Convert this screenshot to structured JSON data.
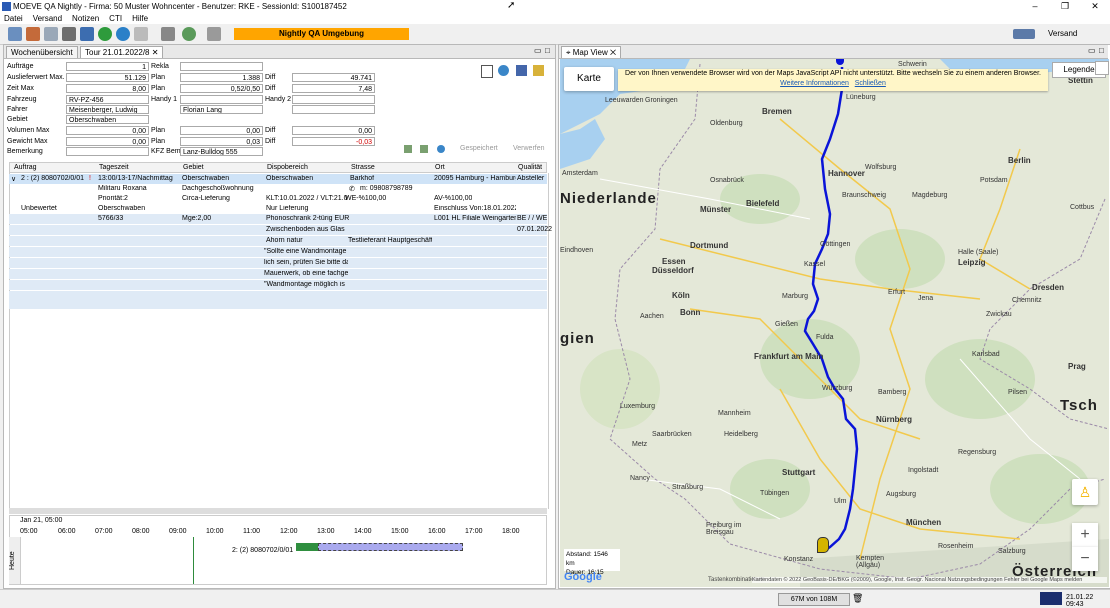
{
  "window": {
    "title": "MOEVE QA Nightly - Firma: 50 Muster Wohncenter - Benutzer: RKE - SessionId: S100187452"
  },
  "menu": [
    "Datei",
    "Versand",
    "Notizen",
    "CTI",
    "Hilfe"
  ],
  "toolbar": {
    "env_label": "Nightly QA Umgebung",
    "right_label": "Versand"
  },
  "left_tabs": {
    "tab1": "Wochenübersicht",
    "tab2": "Tour 21.01.2022/8"
  },
  "form": {
    "auftraege_label": "Aufträge",
    "auftraege_val": "1",
    "rekla_label": "Rekla",
    "auslieferwert_label": "Auslieferwert Max.",
    "auslieferwert_val": "51.129",
    "plan1_label": "Plan",
    "plan1_val": "1.388",
    "diff1_label": "Diff",
    "diff1_val": "49.741",
    "zeit_label": "Zeit Max",
    "zeit_val": "8,00",
    "plan2_label": "Plan",
    "plan2_val": "0,52/0,50",
    "diff2_label": "Diff",
    "diff2_val": "7,48",
    "fahrzeug_label": "Fahrzeug",
    "fahrzeug_val": "RV-PZ-456",
    "handy1_label": "Handy 1",
    "handy2_label": "Handy 2",
    "fahrer_label": "Fahrer",
    "fahrer_val": "Meisenberger, Ludwig",
    "fahrer2_val": "Florian Lang",
    "gebiet_label": "Gebiet",
    "gebiet_val": "Oberschwaben",
    "volumen_label": "Volumen Max",
    "volumen_val": "0,00",
    "plan3_label": "Plan",
    "plan3_val": "0,00",
    "diff3_label": "Diff",
    "diff3_val": "0,00",
    "gewicht_label": "Gewicht Max",
    "gewicht_val": "0,00",
    "plan4_label": "Plan",
    "plan4_val": "0,03",
    "diff4_label": "Diff",
    "diff4_val": "-0,03",
    "bemerkung_label": "Bemerkung",
    "kfz_label": "KFZ Bem",
    "kfz_val": "Lanz-Bulldog   555"
  },
  "actions": {
    "gespeichert": "Gespeichert",
    "verwerfen": "Verwerfen"
  },
  "grid": {
    "headers": [
      "Auftrag",
      "Tageszeit",
      "Gebiet",
      "Dispobereich",
      "Strasse",
      "Ort",
      "Qualität"
    ],
    "r1": [
      "2 : (2) 8080702/0/01",
      "13:00/13-17/Nachmittag",
      "Oberschwaben",
      "Oberschwaben",
      "Barkhof",
      "20095 Hamburg - Hamburg",
      "Absteller"
    ],
    "r2": [
      "Militaru Roxana",
      "Dachgeschoßwohnung",
      "",
      "m: 09808798789"
    ],
    "r3": [
      "Priorität:2",
      "Circa-Lieferung",
      "KLT:10.01.2022 / VLT:21.01.2",
      "WE-%100,00",
      "AV-%100,00"
    ],
    "r4": [
      "Unbewertet",
      "Oberschwaben",
      "Nur Lieferung",
      "Einschluss Von:18.01.2022 E"
    ],
    "r5": [
      "5766/33",
      "Mge:2,00",
      "Phonoschrank 2-türig  EUR",
      "L001 HL Filiale Weingarten",
      "BE / / WE I"
    ],
    "r6": [
      "Zwischenboden aus Glas",
      "07.01.2022"
    ],
    "r7": [
      "Ahorn natur",
      "Testlieferant Hauptgeschäft"
    ],
    "r8": [
      "\"Sollte eine Wandmontage"
    ],
    "r9": [
      "lich sein, prüfen Sie bitte da"
    ],
    "r10": [
      "Mauerwerk, ob eine fachge"
    ],
    "r11": [
      "\"Wandmontage möglich is"
    ]
  },
  "timeline": {
    "date": "Jan 21, 05:00",
    "hours": [
      "05:00",
      "06:00",
      "07:00",
      "08:00",
      "09:00",
      "10:00",
      "11:00",
      "12:00",
      "13:00",
      "14:00",
      "15:00",
      "16:00",
      "17:00",
      "18:00"
    ],
    "side_label": "Heute",
    "job_label": "2: (2) 8080702/0/01"
  },
  "map": {
    "tab": "Map View",
    "karte": "Karte",
    "legende": "Legende",
    "warning": "Der von Ihnen verwendete Browser wird von der Maps JavaScript API nicht unterstützt. Bitte wechseln Sie zu einem anderen Browser.",
    "warning_link1": "Weitere Informationen",
    "warning_link2": "Schließen",
    "distance": "Abstand: 1546 km",
    "duration": "Dauer: 16:15",
    "google": "Google",
    "attrib": "Kartendaten © 2022 GeoBasis-DE/BKG (©2009), Google, Inst. Geogr. Nacional   Nutzungsbedingungen   Fehler bei Google Maps melden",
    "tastenkombinationen": "Tastenkombinationen",
    "route_color": "#0a14d8",
    "cities": [
      "Schwerin",
      "Stettin",
      "Lüneburg",
      "Leeuwarden",
      "Groningen",
      "Oldenburg",
      "Bremen",
      "Amsterdam",
      "Osnabrück",
      "Hannover",
      "Wolfsburg",
      "Berlin",
      "Niederlande",
      "Münster",
      "Bielefeld",
      "Braunschweig",
      "Magdeburg",
      "Potsdam",
      "Cottbus",
      "Eindhoven",
      "Dortmund",
      "Essen",
      "Düsseldorf",
      "Kassel",
      "Göttingen",
      "Halle (Saale)",
      "Leipzig",
      "Dresden",
      "Köln",
      "Bonn",
      "Erfurt",
      "Jena",
      "Zwickau",
      "Chemnitz",
      "Aachen",
      "Gießen",
      "Fulda",
      "Marburg",
      "gien",
      "Frankfurt am Main",
      "Würzburg",
      "Bamberg",
      "Karlsbad",
      "Prag",
      "Pilsen",
      "Luxemburg",
      "Mannheim",
      "Nürnberg",
      "Tsch",
      "Saarbrücken",
      "Heidelberg",
      "Regensburg",
      "Metz",
      "Stuttgart",
      "Ingolstadt",
      "Tübingen",
      "Ulm",
      "Augsburg",
      "Nancy",
      "München",
      "Straßburg",
      "Freiburg im Breisgau",
      "Konstanz",
      "Rosenheim",
      "Salzburg",
      "Kempten (Allgäu)",
      "Österreich"
    ]
  },
  "status": {
    "memory": "67M von 108M",
    "clock": "21.01.22 09:43"
  }
}
